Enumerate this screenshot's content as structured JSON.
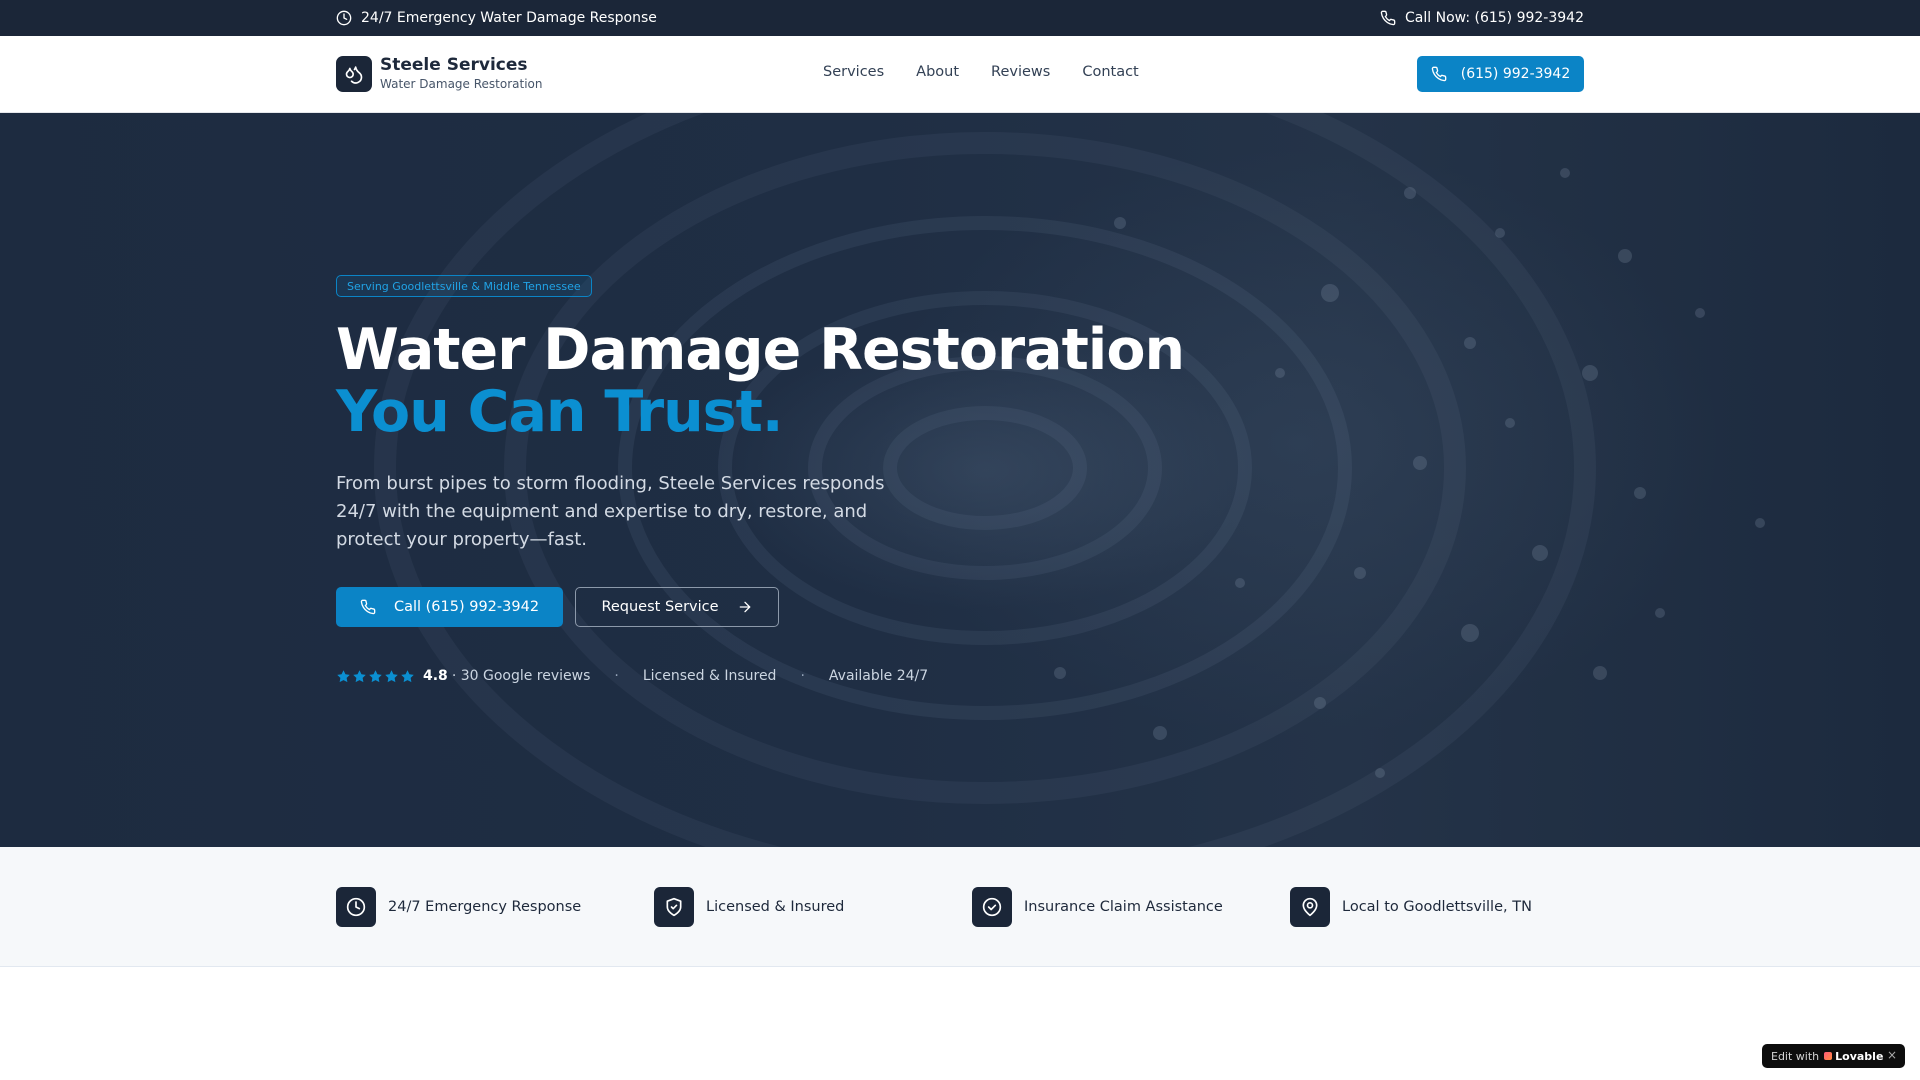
{
  "topbar": {
    "left_text": "24/7 Emergency Water Damage Response",
    "left_icon": "clock-icon",
    "right_text": "Call Now: (615) 992-3942",
    "right_icon": "phone-icon"
  },
  "header": {
    "brand_name": "Steele Services",
    "brand_tagline": "Water Damage Restoration",
    "logo_icon": "droplets-icon",
    "nav": [
      "Services",
      "About",
      "Reviews",
      "Contact"
    ],
    "cta_label": "(615) 992-3942"
  },
  "hero": {
    "badge": "Serving Goodlettsville & Middle Tennessee",
    "headline_line1": "Water Damage Restoration",
    "headline_line2": "You Can Trust.",
    "lead": "From burst pipes to storm flooding, Steele Services responds 24/7 with the equipment and expertise to dry, restore, and protect your property—fast.",
    "primary_button": "Call (615) 992-3942",
    "secondary_button": "Request Service",
    "rating": "4.8",
    "rating_star_count": 5,
    "reviews_text": "· 30 Google reviews",
    "trust_separator": "·",
    "trust_item_1": "Licensed & Insured",
    "trust_item_2": "Available 24/7"
  },
  "features": [
    {
      "icon": "clock-icon",
      "label": "24/7 Emergency Response"
    },
    {
      "icon": "shield-check-icon",
      "label": "Licensed & Insured"
    },
    {
      "icon": "circle-check-icon",
      "label": "Insurance Claim Assistance"
    },
    {
      "icon": "map-pin-icon",
      "label": "Local to Goodlettsville, TN"
    }
  ],
  "lovable": {
    "prefix": "Edit with",
    "brand": "Lovable",
    "close": "×"
  },
  "colors": {
    "navy": "#1b2638",
    "accent": "#0b84c6",
    "accent_text": "#0b8fd1"
  }
}
